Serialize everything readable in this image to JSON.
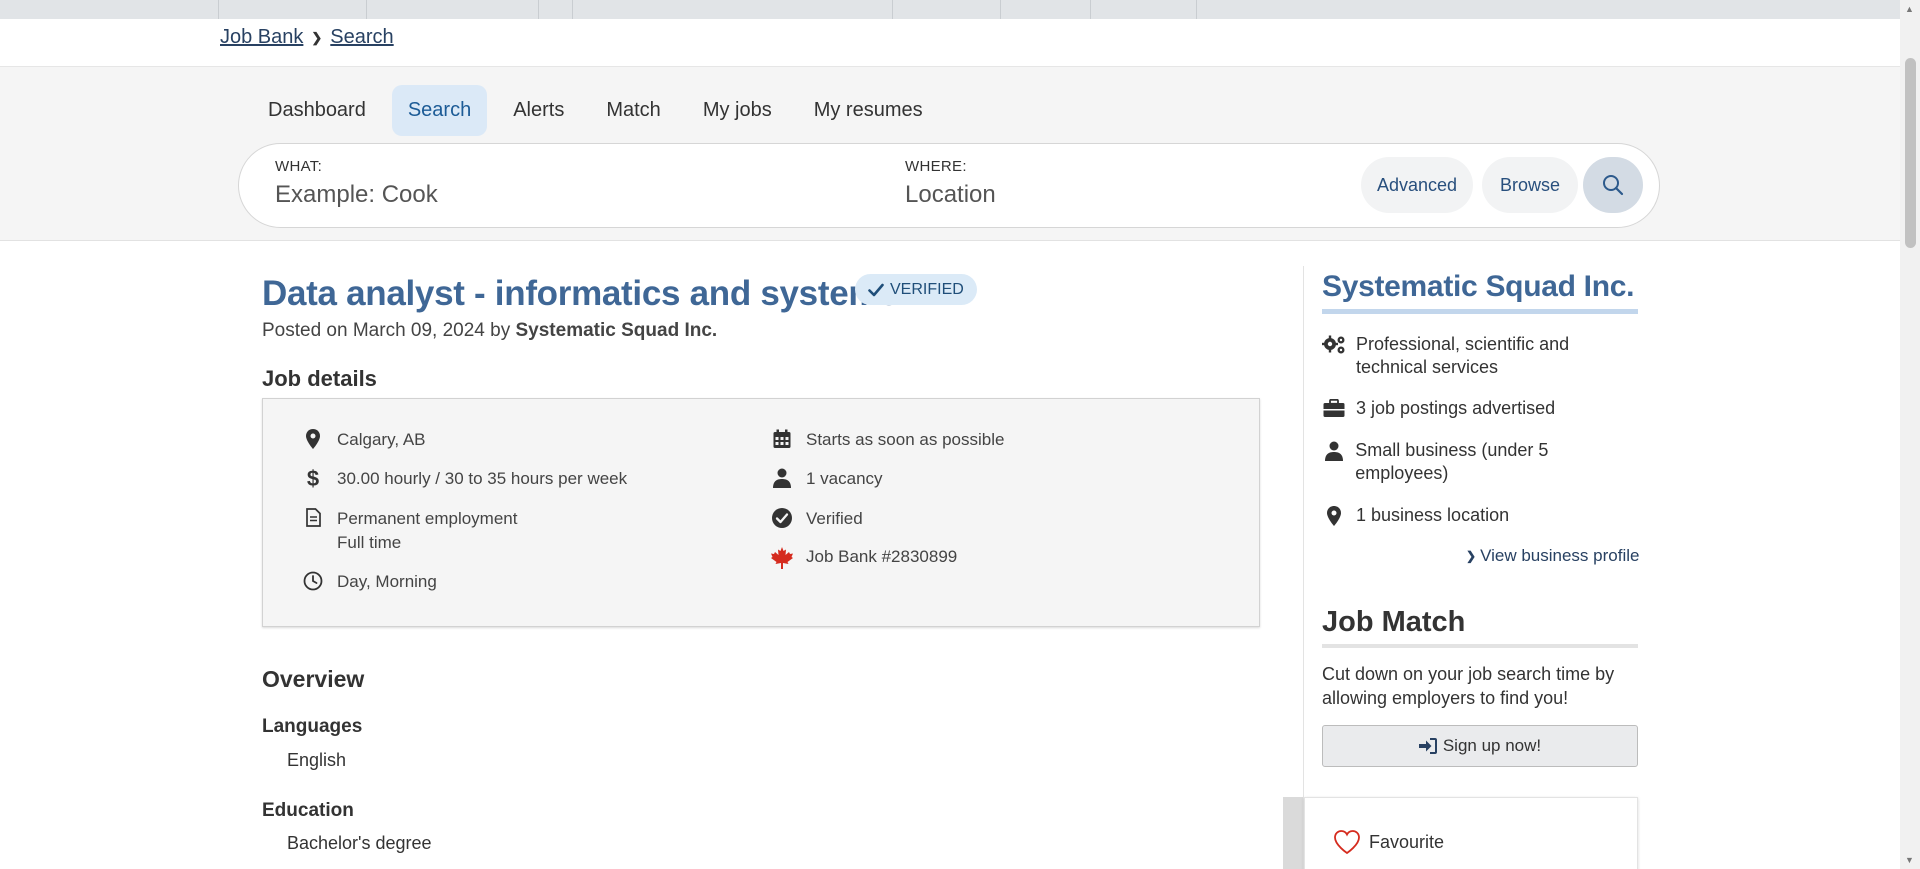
{
  "breadcrumb": {
    "home": "Job Bank",
    "current": "Search"
  },
  "tabs": [
    {
      "label": "Dashboard"
    },
    {
      "label": "Search"
    },
    {
      "label": "Alerts"
    },
    {
      "label": "Match"
    },
    {
      "label": "My jobs"
    },
    {
      "label": "My resumes"
    }
  ],
  "active_tab": "Search",
  "search": {
    "what_label": "WHAT:",
    "what_placeholder": "Example: Cook",
    "where_label": "WHERE:",
    "where_placeholder": "Location",
    "advanced": "Advanced",
    "browse": "Browse",
    "search_icon": "magnifier-icon"
  },
  "job": {
    "title": "Data analyst - informatics and systems",
    "verified_badge": "VERIFIED",
    "posted_prefix": "Posted on March 09, 2024 by",
    "employer": "Systematic Squad Inc."
  },
  "job_details": {
    "heading": "Job details",
    "location": "Calgary, AB",
    "pay": "30.00 hourly / 30 to 35 hours per week",
    "employment_type": "Permanent employment",
    "employment_time": "Full time",
    "schedule": "Day, Morning",
    "start": "Starts as soon as possible",
    "vacancy": "1 vacancy",
    "verified": "Verified",
    "job_bank_number": "Job Bank #2830899"
  },
  "overview": {
    "heading": "Overview",
    "languages_label": "Languages",
    "languages_value": "English",
    "education_label": "Education",
    "education_value": "Bachelor's degree"
  },
  "sidebar": {
    "company": "Systematic Squad Inc.",
    "industry": "Professional, scientific and technical services",
    "postings": "3 job postings advertised",
    "size": "Small business (under 5 employees)",
    "locations": "1 business location",
    "view_profile": "View business profile",
    "job_match_heading": "Job Match",
    "job_match_text": "Cut down on your job search time by allowing employers to find you!",
    "signup": "Sign up now!",
    "favourite": "Favourite"
  },
  "colors": {
    "accent_blue": "#3f6796",
    "link_dark": "#284162",
    "active_tab_bg": "#dbe9f7",
    "maple_red": "#d52b1e"
  }
}
